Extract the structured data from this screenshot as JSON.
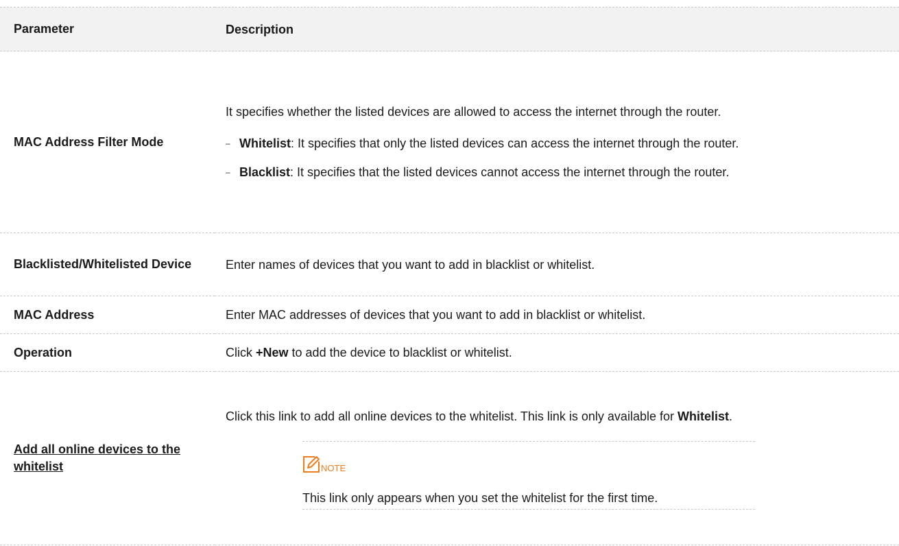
{
  "table": {
    "header": {
      "parameter": "Parameter",
      "description": "Description"
    },
    "rows": {
      "mode": {
        "parameter": "MAC Address Filter Mode",
        "intro": "It specifies whether the listed devices are allowed to access the internet through the router.",
        "bullets": [
          {
            "term": "Whitelist",
            "text": ": It specifies that only the listed devices can access the internet through the router."
          },
          {
            "term": "Blacklist",
            "text": ": It specifies that the listed devices cannot access the internet through the router."
          }
        ]
      },
      "device": {
        "parameter": "Blacklisted/Whitelisted Device",
        "description": "Enter names of devices that you want to add in blacklist or whitelist."
      },
      "mac": {
        "parameter": "MAC Address",
        "description": "Enter MAC addresses of devices that you want to add in blacklist or whitelist."
      },
      "operation": {
        "parameter": "Operation",
        "desc_prefix": "Click ",
        "desc_bold": "+New",
        "desc_suffix": " to add the device to blacklist or whitelist."
      },
      "add_all": {
        "parameter": "Add all online devices to the whitelist",
        "desc_text": "Click this link to add all online devices to the whitelist. This link is only available for ",
        "desc_bold": "Whitelist",
        "desc_end": ".",
        "note": {
          "label": "NOTE",
          "icon": "note-pencil-icon",
          "icon_color": "#f07c1c",
          "text": "This link only appears when you set the whitelist for the first time."
        }
      }
    }
  },
  "colors": {
    "header_bg": "#f2f2f2",
    "border": "#c9c9c9",
    "note_accent": "#f07c1c"
  }
}
